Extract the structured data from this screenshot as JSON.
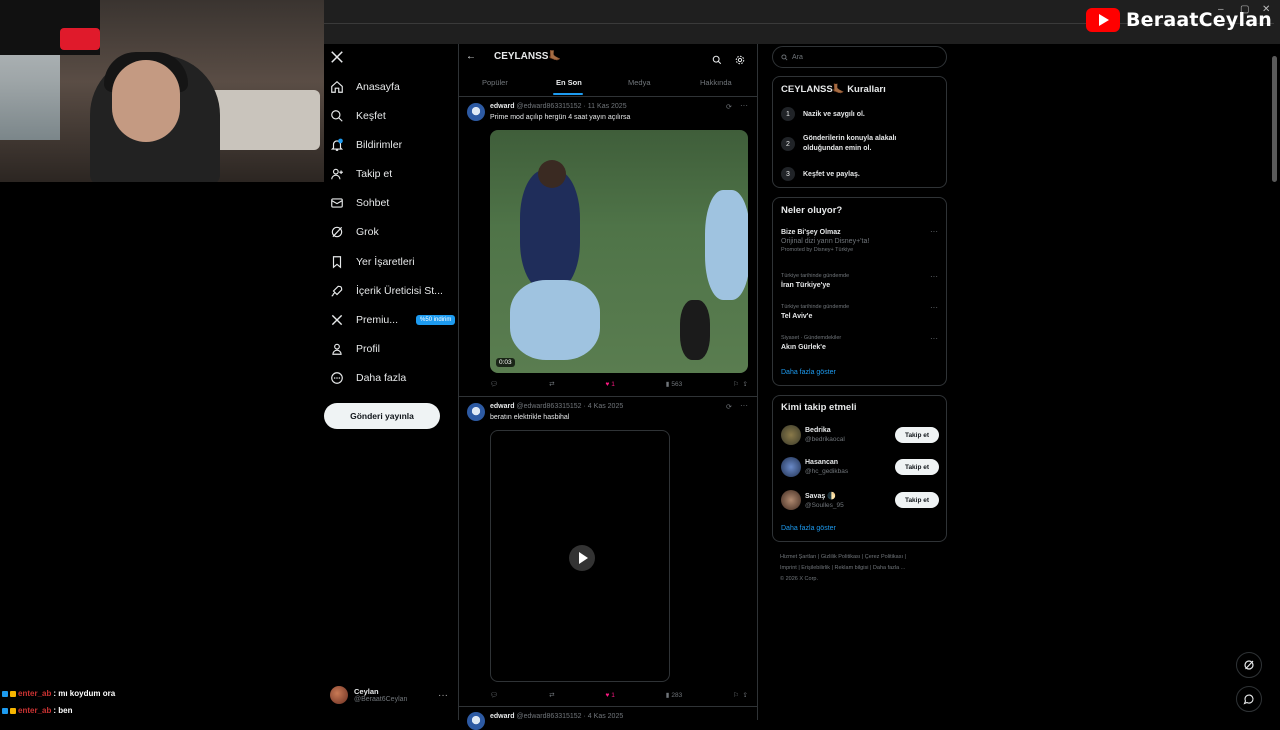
{
  "stream": {
    "channel_name": "BeraatCeylan"
  },
  "nav": {
    "items": [
      {
        "label": "Anasayfa",
        "icon": "home-icon"
      },
      {
        "label": "Keşfet",
        "icon": "search-icon"
      },
      {
        "label": "Bildirimler",
        "icon": "bell-icon"
      },
      {
        "label": "Takip et",
        "icon": "add-user-icon"
      },
      {
        "label": "Sohbet",
        "icon": "mail-icon"
      },
      {
        "label": "Grok",
        "icon": "grok-icon"
      },
      {
        "label": "Yer İşaretleri",
        "icon": "bookmark-icon"
      },
      {
        "label": "İçerik Üreticisi St...",
        "icon": "rocket-icon"
      },
      {
        "label": "Premiu...",
        "icon": "x-icon",
        "badge": "%50 indirim"
      },
      {
        "label": "Profil",
        "icon": "person-icon"
      },
      {
        "label": "Daha fazla",
        "icon": "more-circle-icon"
      }
    ],
    "post_button": "Gönderi yayınla",
    "account": {
      "name": "Ceylan",
      "handle": "@Beraat6Ceylan"
    }
  },
  "chat": [
    {
      "user": "enter_ab",
      "message": ": mı koydum ora"
    },
    {
      "user": "enter_ab",
      "message": ": ben"
    }
  ],
  "community": {
    "title": "CEYLANSS🦶🏾",
    "tabs": [
      "Popüler",
      "En Son",
      "Medya",
      "Hakkında"
    ],
    "active_tab": "En Son"
  },
  "tweets": [
    {
      "name": "edward",
      "handle": "@edward863315152",
      "date": "· 11 Kas 2025",
      "text": "Prime mod açılıp hergün 4 saat yayın açılırsa",
      "duration": "0:03",
      "likes": "1",
      "views": "563"
    },
    {
      "name": "edward",
      "handle": "@edward863315152",
      "date": "· 4 Kas 2025",
      "text": "beratın elektrikle hasbihal",
      "likes": "1",
      "views": "283"
    },
    {
      "name": "edward",
      "handle": "@edward863315152",
      "date": "· 4 Kas 2025"
    }
  ],
  "search": {
    "placeholder": "Ara"
  },
  "rules": {
    "title": "CEYLANSS🦶🏾 Kuralları",
    "items": [
      {
        "num": "1",
        "text": "Nazik ve saygılı ol."
      },
      {
        "num": "2",
        "text": "Gönderilerin konuyla alakalı olduğundan emin ol."
      },
      {
        "num": "3",
        "text": "Keşfet ve paylaş."
      }
    ]
  },
  "trends": {
    "title": "Neler oluyor?",
    "promo": {
      "name": "Bize Bi'şey Olmaz",
      "desc": "Orijinal dizi yarın Disney+'ta!",
      "by": "Promoted by Disney+ Türkiye"
    },
    "items": [
      {
        "meta": "Türkiye tarihinde gündemde",
        "name": "İran Türkiye'ye"
      },
      {
        "meta": "Türkiye tarihinde gündemde",
        "name": "Tel Aviv'e"
      },
      {
        "meta": "Siyaset · Gündemdekiler",
        "name": "Akın Gürlek'e"
      }
    ],
    "show_more": "Daha fazla göster"
  },
  "who_to_follow": {
    "title": "Kimi takip etmeli",
    "button": "Takip et",
    "items": [
      {
        "name": "Bedrika",
        "handle": "@bedrikaocal"
      },
      {
        "name": "Hasancan",
        "handle": "@hc_gedikbas"
      },
      {
        "name": "Savaş 🌓",
        "handle": "@Soulles_95"
      }
    ],
    "show_more": "Daha fazla göster"
  },
  "footer": {
    "line1": "Hizmet Şartları  |  Gizlilik Politikası  |  Çerez Politikası  |",
    "line2": "Imprint  |  Erişilebilirlik  |  Reklam bilgisi  |  Daha fazla ...",
    "line3": "© 2026 X Corp."
  },
  "colors": {
    "accent": "#1d9bf0",
    "like": "#f91880",
    "yt": "#ff0000"
  }
}
